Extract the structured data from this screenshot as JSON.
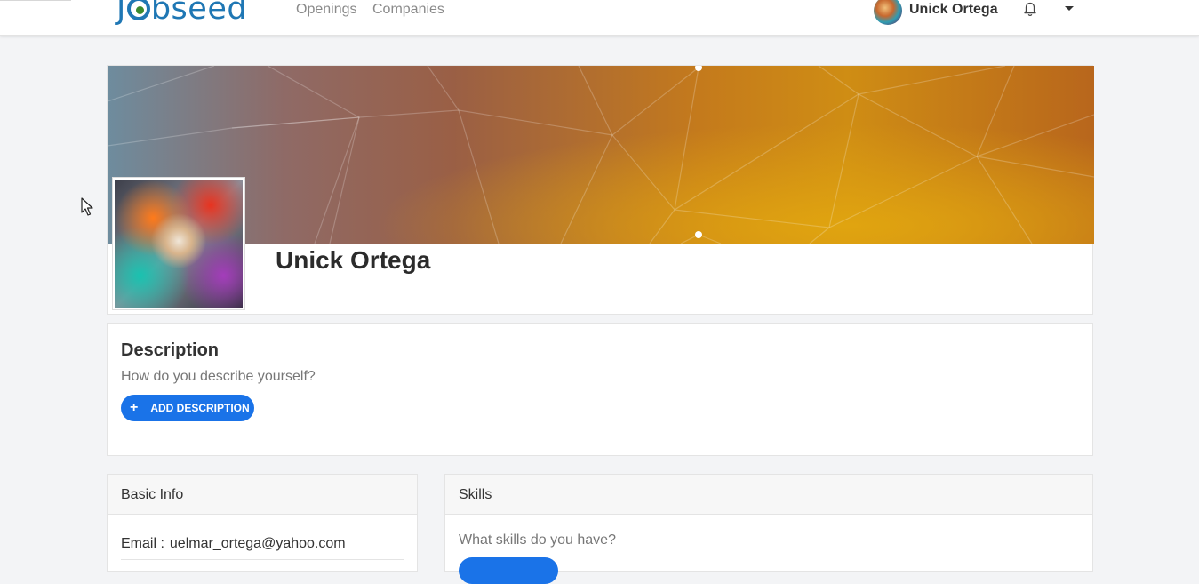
{
  "nav": {
    "logo": "Jobseed",
    "links": [
      "Openings",
      "Companies"
    ],
    "username": "Unick Ortega"
  },
  "icons": {
    "bell": "bell-icon",
    "caret": "caret-down-icon",
    "plus": "plus-icon",
    "cursor": "cursor-icon"
  },
  "profile": {
    "name": "Unick Ortega"
  },
  "description": {
    "title": "Description",
    "hint": "How do you describe yourself?",
    "button_icon": "+",
    "button_label": "ADD DESCRIPTION"
  },
  "basic_info": {
    "title": "Basic Info",
    "email_label": "Email :",
    "email_value": "uelmar_ortega@yahoo.com"
  },
  "skills": {
    "title": "Skills",
    "hint": "What skills do you have?"
  },
  "colors": {
    "primary": "#1a73e8",
    "logo": "#1f77b4",
    "background": "#f3f4f6"
  }
}
